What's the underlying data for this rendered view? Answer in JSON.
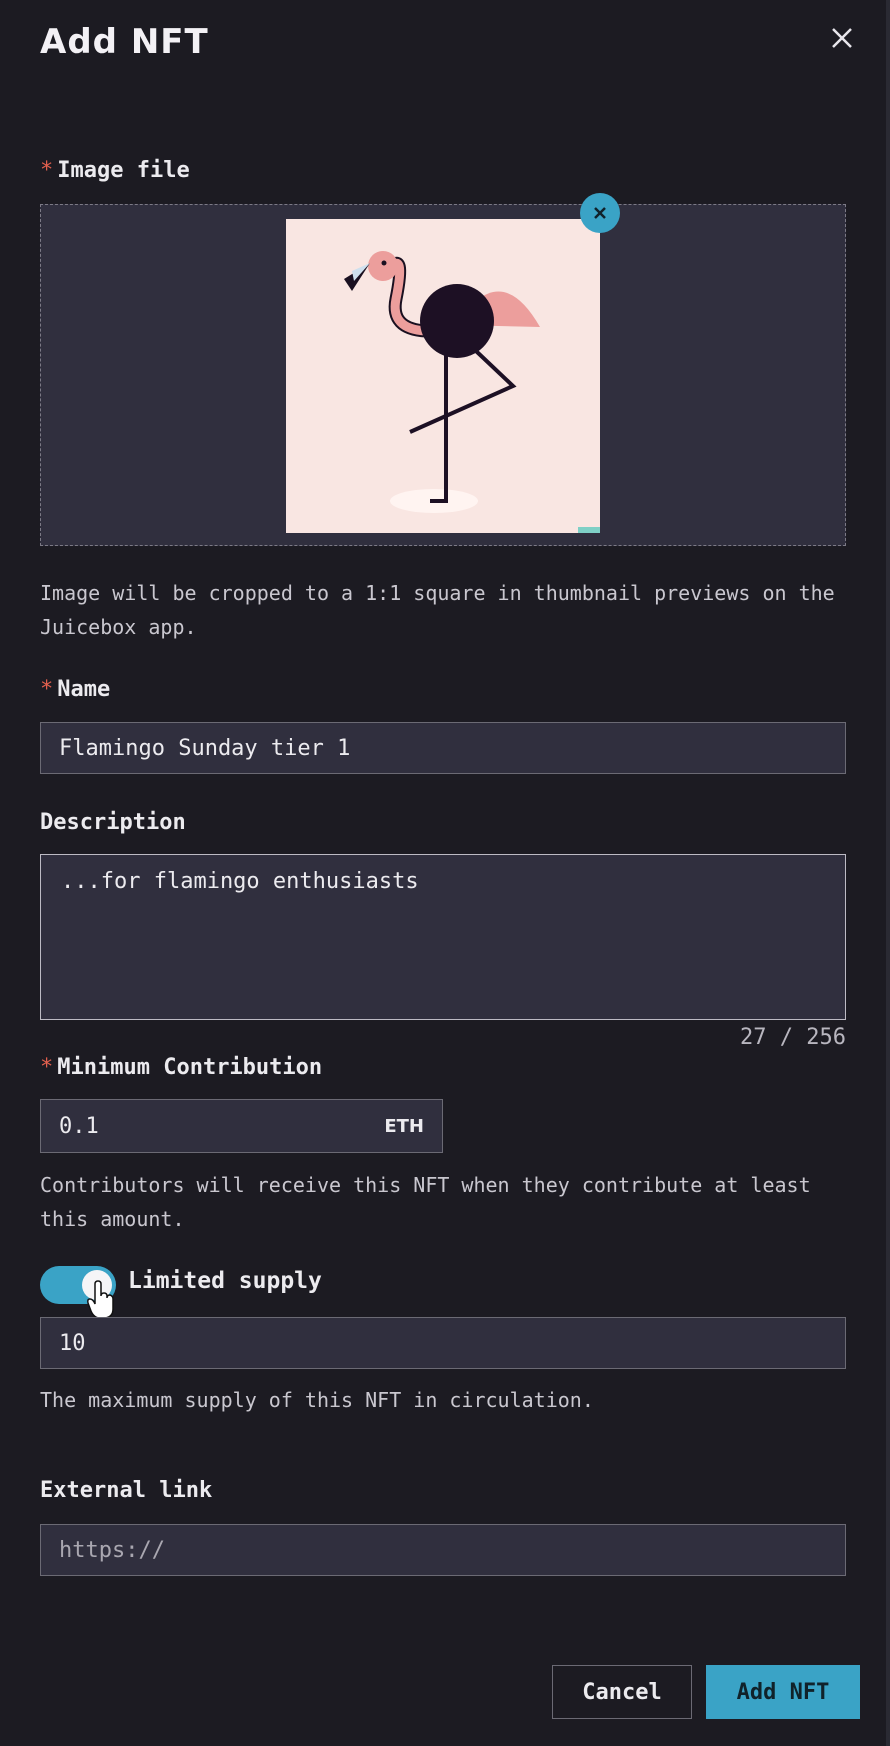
{
  "modal": {
    "title": "Add NFT"
  },
  "image_field": {
    "label": "Image file",
    "required_marker": "*",
    "help": "Image will be cropped to a 1:1 square in thumbnail previews on the Juicebox app."
  },
  "name_field": {
    "label": "Name",
    "required_marker": "*",
    "value": "Flamingo Sunday tier 1"
  },
  "description_field": {
    "label": "Description",
    "value": "...for flamingo enthusiasts",
    "counter": "27 / 256"
  },
  "contribution_field": {
    "label": "Minimum Contribution",
    "required_marker": "*",
    "value": "0.1",
    "unit": "ETH",
    "help": "Contributors will receive this NFT when they contribute at least this amount."
  },
  "supply_field": {
    "toggle_label": "Limited supply",
    "toggle_on": true,
    "value": "10",
    "help": "The maximum supply of this NFT in circulation."
  },
  "link_field": {
    "label": "External link",
    "placeholder": "https://"
  },
  "footer": {
    "cancel_label": "Cancel",
    "submit_label": "Add NFT"
  },
  "colors": {
    "background": "#1c1b22",
    "input_bg": "#302f3e",
    "accent": "#3aa3c6",
    "required": "#e3604e"
  },
  "icons": {
    "close": "close-icon",
    "remove_image": "remove-image-icon",
    "cursor": "hand-cursor-icon"
  }
}
